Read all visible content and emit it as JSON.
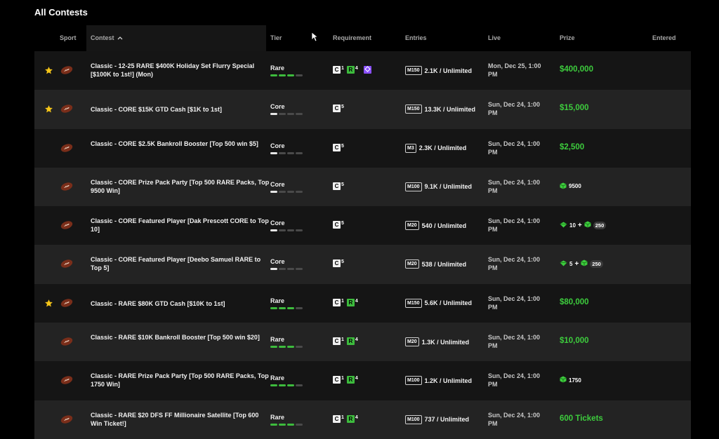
{
  "page": {
    "title": "All Contests"
  },
  "headers": {
    "sport": "Sport",
    "contest": "Contest",
    "tier": "Tier",
    "requirement": "Requirement",
    "entries": "Entries",
    "live": "Live",
    "prize": "Prize",
    "entered": "Entered"
  },
  "colors": {
    "accent_green": "#3dcc3d",
    "rare_bar": "#3dbb3d",
    "star": "#f5c518",
    "purple": "#8a4fff"
  },
  "icons": {
    "sport": "football-icon",
    "featured": "star-icon",
    "pack": "pack-icon",
    "gem": "gem-icon"
  },
  "rows": [
    {
      "featured": true,
      "title": "Classic - 12-25 RARE $400K Holiday Set Flurry Special [$100K to 1st!] (Mon)",
      "tier": "Rare",
      "req": {
        "c": "C",
        "c_sup": "1",
        "r": "R",
        "r_sup": "4",
        "purple": true
      },
      "entries_box": "M150",
      "entries": "2.1K / Unlimited",
      "live": "Mon, Dec 25, 1:00 PM",
      "prize_type": "cash",
      "prize": "$400,000"
    },
    {
      "featured": true,
      "title": "Classic - CORE $15K GTD Cash [$1K to 1st]",
      "tier": "Core",
      "req": {
        "c": "C",
        "c_sup": "5"
      },
      "entries_box": "M150",
      "entries": "13.3K / Unlimited",
      "live": "Sun, Dec 24, 1:00 PM",
      "prize_type": "cash",
      "prize": "$15,000"
    },
    {
      "featured": false,
      "title": "Classic - CORE $2.5K Bankroll Booster [Top 500 win $5]",
      "tier": "Core",
      "req": {
        "c": "C",
        "c_sup": "5"
      },
      "entries_box": "M3",
      "entries": "2.3K / Unlimited",
      "live": "Sun, Dec 24, 1:00 PM",
      "prize_type": "cash",
      "prize": "$2,500"
    },
    {
      "featured": false,
      "title": "Classic - CORE Prize Pack Party [Top 500 RARE Packs, Top 9500 Win]",
      "tier": "Core",
      "req": {
        "c": "C",
        "c_sup": "5"
      },
      "entries_box": "M100",
      "entries": "9.1K / Unlimited",
      "live": "Sun, Dec 24, 1:00 PM",
      "prize_type": "pack",
      "pack_count": "9500"
    },
    {
      "featured": false,
      "title": "Classic - CORE Featured Player [Dak Prescott CORE to Top 10]",
      "tier": "Core",
      "req": {
        "c": "C",
        "c_sup": "5"
      },
      "entries_box": "M20",
      "entries": "540 / Unlimited",
      "live": "Sun, Dec 24, 1:00 PM",
      "prize_type": "combo",
      "gem_count": "10",
      "plus": "+",
      "pack_count": "250"
    },
    {
      "featured": false,
      "title": "Classic - CORE Featured Player [Deebo Samuel RARE to Top 5]",
      "tier": "Core",
      "req": {
        "c": "C",
        "c_sup": "5"
      },
      "entries_box": "M20",
      "entries": "538 / Unlimited",
      "live": "Sun, Dec 24, 1:00 PM",
      "prize_type": "combo",
      "gem_count": "5",
      "plus": "+",
      "pack_count": "250"
    },
    {
      "featured": true,
      "title": "Classic - RARE $80K GTD Cash [$10K to 1st]",
      "tier": "Rare",
      "req": {
        "c": "C",
        "c_sup": "1",
        "r": "R",
        "r_sup": "4"
      },
      "entries_box": "M150",
      "entries": "5.6K / Unlimited",
      "live": "Sun, Dec 24, 1:00 PM",
      "prize_type": "cash",
      "prize": "$80,000"
    },
    {
      "featured": false,
      "title": "Classic - RARE $10K Bankroll Booster [Top 500 win $20]",
      "tier": "Rare",
      "req": {
        "c": "C",
        "c_sup": "1",
        "r": "R",
        "r_sup": "4"
      },
      "entries_box": "M20",
      "entries": "1.3K / Unlimited",
      "live": "Sun, Dec 24, 1:00 PM",
      "prize_type": "cash",
      "prize": "$10,000"
    },
    {
      "featured": false,
      "title": "Classic - RARE Prize Pack Party [Top 500 RARE Packs, Top 1750 Win]",
      "tier": "Rare",
      "req": {
        "c": "C",
        "c_sup": "1",
        "r": "R",
        "r_sup": "4"
      },
      "entries_box": "M100",
      "entries": "1.2K / Unlimited",
      "live": "Sun, Dec 24, 1:00 PM",
      "prize_type": "pack",
      "pack_count": "1750"
    },
    {
      "featured": false,
      "title": "Classic - RARE $20 DFS FF Millionaire Satellite [Top 600 Win Ticket!]",
      "tier": "Rare",
      "req": {
        "c": "C",
        "c_sup": "1",
        "r": "R",
        "r_sup": "4"
      },
      "entries_box": "M100",
      "entries": "737 / Unlimited",
      "live": "Sun, Dec 24, 1:00 PM",
      "prize_type": "cash",
      "prize": "600 Tickets"
    }
  ]
}
